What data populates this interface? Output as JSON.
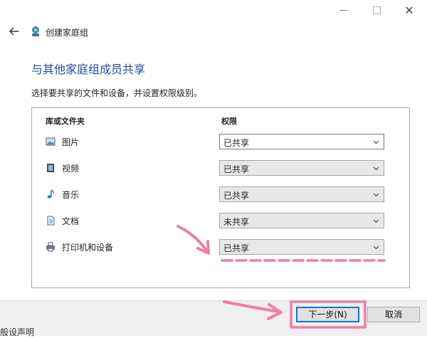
{
  "window": {
    "controls": {
      "minimize": "minimize",
      "maximize": "maximize",
      "close": "close"
    }
  },
  "header": {
    "back_icon": "back-arrow-icon",
    "app_icon": "homegroup-icon",
    "title": "创建家庭组"
  },
  "page": {
    "heading": "与其他家庭组成员共享",
    "instruction": "选择要共享的文件和设备，并设置权限级别。"
  },
  "table": {
    "col_library": "库或文件夹",
    "col_permission": "权限",
    "rows": [
      {
        "label": "图片",
        "icon": "pictures-icon",
        "value": "已共享",
        "active": true
      },
      {
        "label": "视频",
        "icon": "videos-icon",
        "value": "已共享",
        "active": false
      },
      {
        "label": "音乐",
        "icon": "music-icon",
        "value": "已共享",
        "active": false
      },
      {
        "label": "文档",
        "icon": "documents-icon",
        "value": "未共享",
        "active": false
      },
      {
        "label": "打印机和设备",
        "icon": "printer-icon",
        "value": "已共享",
        "active": false
      }
    ]
  },
  "buttons": {
    "next": "下一步(N)",
    "cancel": "取消"
  },
  "footer": {
    "partial_text": "般设声明"
  },
  "colors": {
    "heading": "#1e4f9a",
    "annotation": "#f07ca7",
    "default_button_border": "#0078d7"
  }
}
